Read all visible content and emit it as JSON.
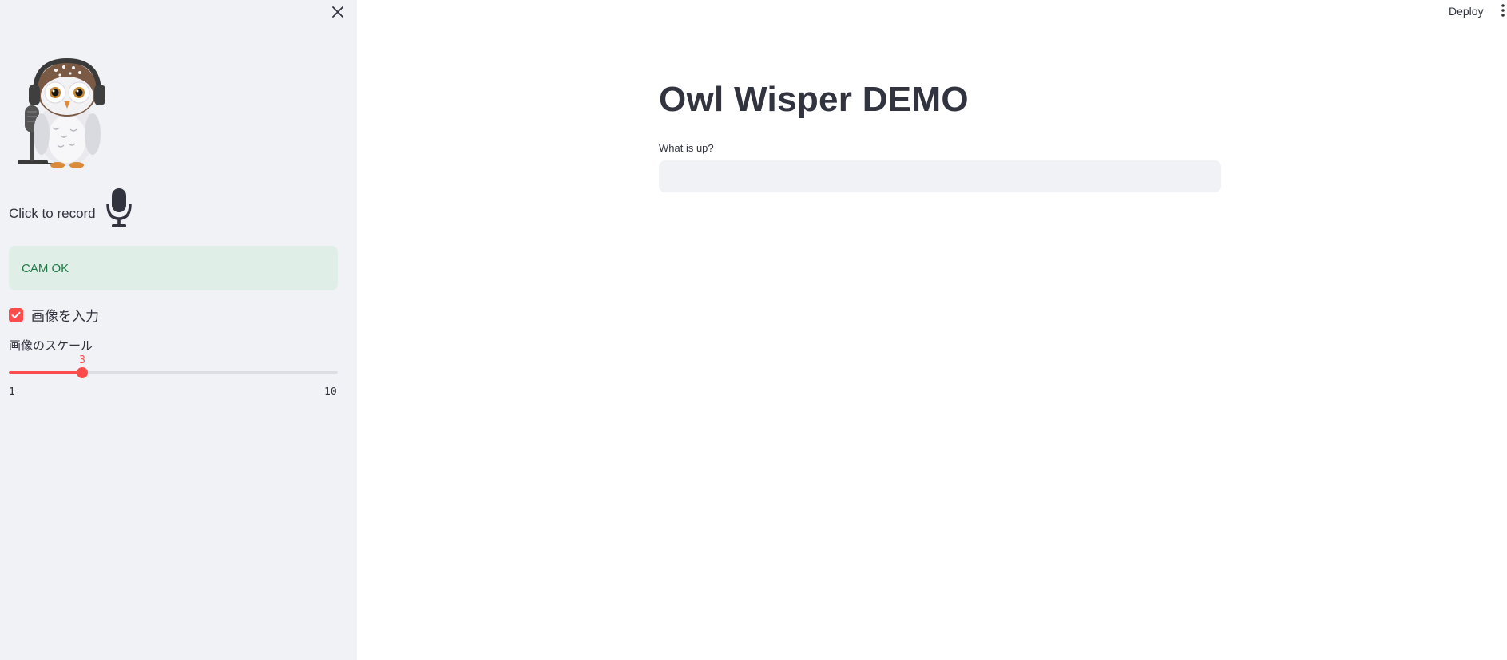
{
  "sidebar": {
    "close_icon": "close-icon",
    "logo_icon": "owl-headphones-microphone-image",
    "record": {
      "label": "Click to record",
      "icon": "microphone-icon"
    },
    "status_alert": "CAM OK",
    "image_input_checkbox": {
      "label": "画像を入力",
      "checked": true
    },
    "image_scale_slider": {
      "label": "画像のスケール",
      "value": 3,
      "value_label": "3",
      "min": 1,
      "max": 10,
      "min_label": "1",
      "max_label": "10"
    }
  },
  "toolbar": {
    "deploy_label": "Deploy",
    "menu_icon": "vertical-dots-menu-icon"
  },
  "main": {
    "title": "Owl Wisper DEMO",
    "input_label": "What is up?",
    "input_value": ""
  },
  "colors": {
    "accent": "#ff4b4b",
    "sidebar_bg": "#f0f2f6",
    "alert_bg": "#dfeee6",
    "alert_text": "#1f7a45",
    "text": "#31333f"
  }
}
